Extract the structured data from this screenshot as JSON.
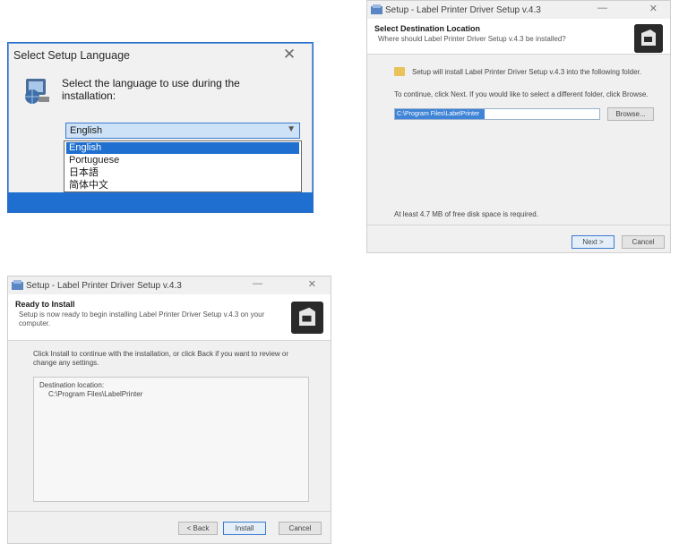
{
  "lang_dialog": {
    "title": "Select Setup Language",
    "close_glyph": "✕",
    "prompt": "Select the language to use during the installation:",
    "selected": "English",
    "options": [
      "English",
      "Portuguese",
      "日本語",
      "简体中文"
    ]
  },
  "location_dialog": {
    "title": "Setup - Label Printer Driver Setup v.4.3",
    "minimize_glyph": "—",
    "close_glyph": "✕",
    "heading": "Select Destination Location",
    "subheading": "Where should Label Printer Driver Setup v.4.3 be installed?",
    "info_line": "Setup will install Label Printer Driver Setup v.4.3 into the following folder.",
    "continue_line": "To continue, click Next. If you would like to select a different folder, click Browse.",
    "path_value": "C:\\Program Files\\LabelPrinter",
    "browse_label": "Browse...",
    "space_line": "At least 4.7 MB of free disk space is required.",
    "next_label": "Next >",
    "cancel_label": "Cancel"
  },
  "ready_dialog": {
    "title": "Setup - Label Printer Driver Setup v.4.3",
    "minimize_glyph": "—",
    "close_glyph": "✕",
    "heading": "Ready to Install",
    "subheading": "Setup is now ready to begin installing Label Printer Driver Setup v.4.3 on your computer.",
    "instructions": "Click Install to continue with the installation, or click Back if you want to review or change any settings.",
    "memo_label": "Destination location:",
    "memo_value": "C:\\Program Files\\LabelPrinter",
    "back_label": "< Back",
    "install_label": "Install",
    "cancel_label": "Cancel"
  },
  "colors": {
    "accent": "#1e6fd0",
    "dialog_bg": "#f0f0f0",
    "warning_icon": "#e8c25a"
  },
  "icons": [
    "globe-computer-icon",
    "setup-icon",
    "wizard-image-icon",
    "folder-icon",
    "chevron-down-icon",
    "close-icon",
    "minimize-icon"
  ]
}
